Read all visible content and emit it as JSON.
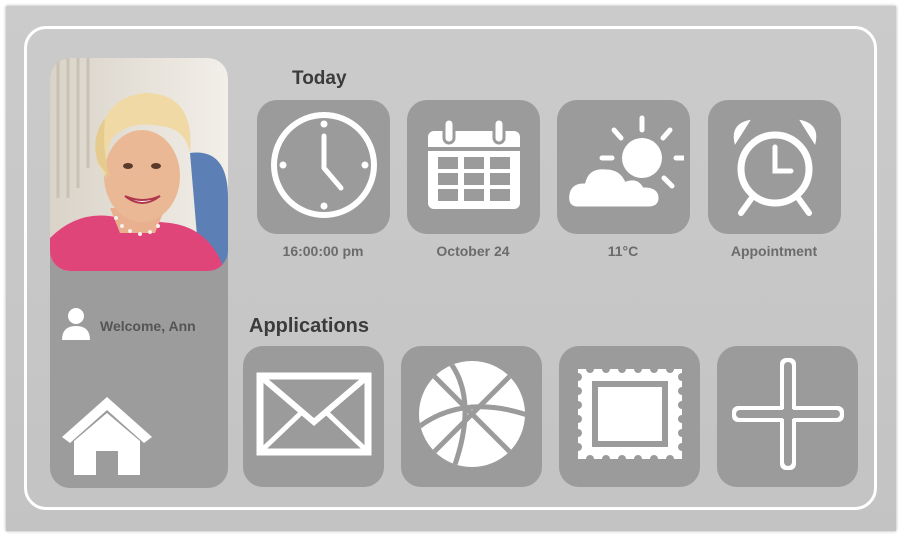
{
  "user": {
    "welcome": "Welcome, Ann"
  },
  "today": {
    "heading": "Today",
    "widgets": [
      {
        "icon": "clock-icon",
        "caption": "16:00:00 pm"
      },
      {
        "icon": "calendar-icon",
        "caption": "October 24"
      },
      {
        "icon": "weather-icon",
        "caption": "11°C"
      },
      {
        "icon": "alarm-clock-icon",
        "caption": "Appointment"
      }
    ]
  },
  "applications": {
    "heading": "Applications",
    "apps": [
      {
        "icon": "mail-icon"
      },
      {
        "icon": "basketball-icon"
      },
      {
        "icon": "stamp-photo-icon"
      },
      {
        "icon": "add-plus-icon"
      }
    ]
  },
  "colors": {
    "tile": "#9b9b9b",
    "background": "#c6c6c6",
    "icon": "#ffffff",
    "caption": "#6b6b6b"
  }
}
